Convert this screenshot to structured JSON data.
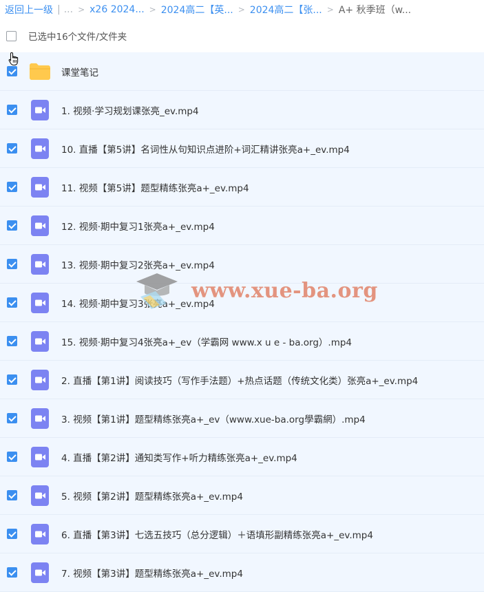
{
  "breadcrumb": {
    "back": "返回上一级",
    "divider": "|",
    "ellipsis": "...",
    "items": [
      "x26 2024...",
      "2024高二【英...",
      "2024高二【张...",
      "A+ 秋季班（w..."
    ]
  },
  "selection": {
    "text": "已选中16个文件/文件夹"
  },
  "files": [
    {
      "name": "课堂笔记",
      "type": "folder"
    },
    {
      "name": "1. 视频·学习规划课张亮_ev.mp4",
      "type": "video"
    },
    {
      "name": "10. 直播【第5讲】名词性从句知识点进阶+词汇精讲张亮a+_ev.mp4",
      "type": "video"
    },
    {
      "name": "11. 视频【第5讲】题型精练张亮a+_ev.mp4",
      "type": "video"
    },
    {
      "name": "12. 视频·期中复习1张亮a+_ev.mp4",
      "type": "video"
    },
    {
      "name": "13. 视频·期中复习2张亮a+_ev.mp4",
      "type": "video"
    },
    {
      "name": "14. 视频·期中复习3张亮a+_ev.mp4",
      "type": "video"
    },
    {
      "name": "15. 视频·期中复习4张亮a+_ev（学霸网 www.x u e - ba.org）.mp4",
      "type": "video"
    },
    {
      "name": "2. 直播【第1讲】阅读技巧（写作手法题）+热点话题（传统文化类）张亮a+_ev.mp4",
      "type": "video"
    },
    {
      "name": "3. 视频【第1讲】题型精练张亮a+_ev（www.xue-ba.org學霸網）.mp4",
      "type": "video"
    },
    {
      "name": "4. 直播【第2讲】通知类写作+听力精练张亮a+_ev.mp4",
      "type": "video"
    },
    {
      "name": "5. 视频【第2讲】题型精练张亮a+_ev.mp4",
      "type": "video"
    },
    {
      "name": "6. 直播【第3讲】七选五技巧（总分逻辑）＋语填形副精练张亮a+_ev.mp4",
      "type": "video"
    },
    {
      "name": "7. 视频【第3讲】题型精练张亮a+_ev.mp4",
      "type": "video"
    }
  ],
  "watermark": {
    "text": "www.xue-ba.org"
  },
  "colors": {
    "accent": "#3b8ff0",
    "row_background": "#f1f7ff",
    "folder": "#ffc94d",
    "video_icon": "#7c83f2",
    "watermark": "#e07f63"
  },
  "icons": {
    "folder": "folder-icon",
    "video": "video-file-icon",
    "cursor": "hand-cursor-icon"
  }
}
